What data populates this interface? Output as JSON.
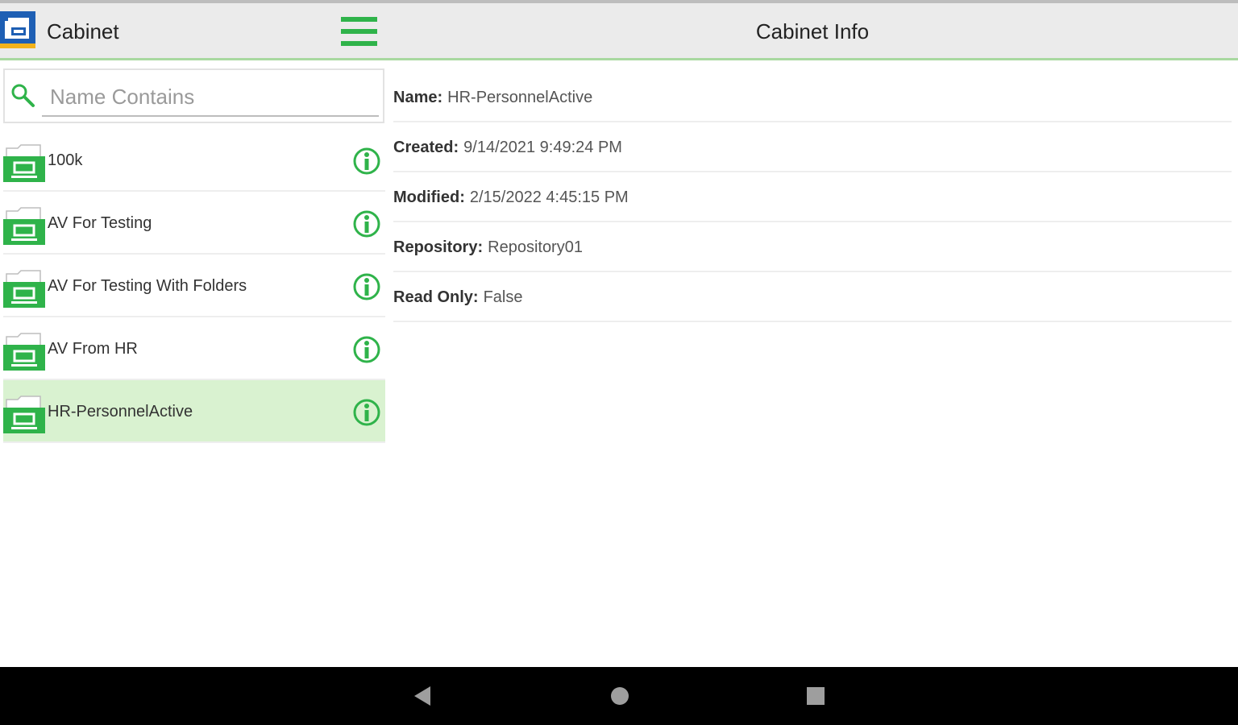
{
  "header": {
    "app_title": "Cabinet",
    "panel_title": "Cabinet Info"
  },
  "search": {
    "placeholder": "Name Contains",
    "value": ""
  },
  "cabinets": [
    {
      "label": "100k",
      "selected": false
    },
    {
      "label": "AV For Testing",
      "selected": false
    },
    {
      "label": "AV For Testing With Folders",
      "selected": false
    },
    {
      "label": "AV From HR",
      "selected": false
    },
    {
      "label": "HR-PersonnelActive",
      "selected": true
    }
  ],
  "info": {
    "name_label": "Name:",
    "name_value": "HR-PersonnelActive",
    "created_label": "Created:",
    "created_value": "9/14/2021 9:49:24 PM",
    "modified_label": "Modified:",
    "modified_value": "2/15/2022 4:45:15 PM",
    "repository_label": "Repository:",
    "repository_value": "Repository01",
    "readonly_label": "Read Only:",
    "readonly_value": "False"
  },
  "colors": {
    "accent_green": "#2fb34a",
    "selected_row": "#d9f2d0",
    "header_bg": "#ebebeb",
    "nav_bar": "#000000"
  },
  "icons": {
    "logo": "cabinet-logo-icon",
    "menu": "hamburger-menu-icon",
    "search": "search-icon",
    "folder": "folder-icon",
    "info": "info-icon",
    "back": "back-icon",
    "home": "home-icon",
    "recent": "recent-apps-icon"
  }
}
